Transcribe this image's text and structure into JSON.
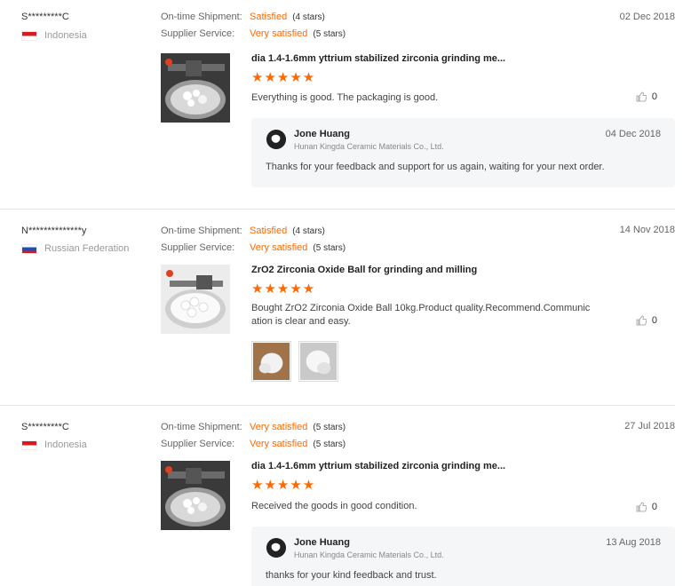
{
  "labels": {
    "on_time_shipment": "On-time Shipment:",
    "supplier_service": "Supplier Service:"
  },
  "colors": {
    "accent": "#ff6a00",
    "reply_bg": "#f5f6f8"
  },
  "reviews": [
    {
      "buyer": "S*********C",
      "country": "Indonesia",
      "flag": "indonesia-flag-icon",
      "shipment": "Satisfied",
      "shipment_stars": "(4 stars)",
      "service": "Very satisfied",
      "service_stars": "(5 stars)",
      "date": "02 Dec 2018",
      "product": "dia 1.4-1.6mm yttrium stabilized zirconia grinding me...",
      "stars": "★★★★★",
      "rating": 5,
      "comment": "Everything is good. The packaging is good.",
      "likes": "0",
      "reply": {
        "name": "Jone Huang",
        "company": "Hunan Kingda Ceramic Materials Co., Ltd.",
        "date": "04 Dec 2018",
        "text": "Thanks for your feedback and support for us again, waiting for your next order."
      }
    },
    {
      "buyer": "N**************y",
      "country": "Russian Federation",
      "flag": "russia-flag-icon",
      "shipment": "Satisfied",
      "shipment_stars": "(4 stars)",
      "service": "Very satisfied",
      "service_stars": "(5 stars)",
      "date": "14 Nov 2018",
      "product": "ZrO2 Zirconia Oxide Ball for grinding and milling",
      "stars": "★★★★★",
      "rating": 5,
      "comment_line1": "Bought ZrO2 Zirconia Oxide Ball 10kg.Product quality.Recommend.Communic",
      "comment_line2": "ation is clear and easy.",
      "likes": "0"
    },
    {
      "buyer": "S*********C",
      "country": "Indonesia",
      "flag": "indonesia-flag-icon",
      "shipment": "Very satisfied",
      "shipment_stars": "(5 stars)",
      "service": "Very satisfied",
      "service_stars": "(5 stars)",
      "date": "27 Jul 2018",
      "product": "dia 1.4-1.6mm yttrium stabilized zirconia grinding me...",
      "stars": "★★★★★",
      "rating": 5,
      "comment": "Received the goods in good condition.",
      "likes": "0",
      "reply": {
        "name": "Jone Huang",
        "company": "Hunan Kingda Ceramic Materials Co., Ltd.",
        "date": "13 Aug 2018",
        "text": "thanks for your kind feedback and trust."
      }
    }
  ]
}
